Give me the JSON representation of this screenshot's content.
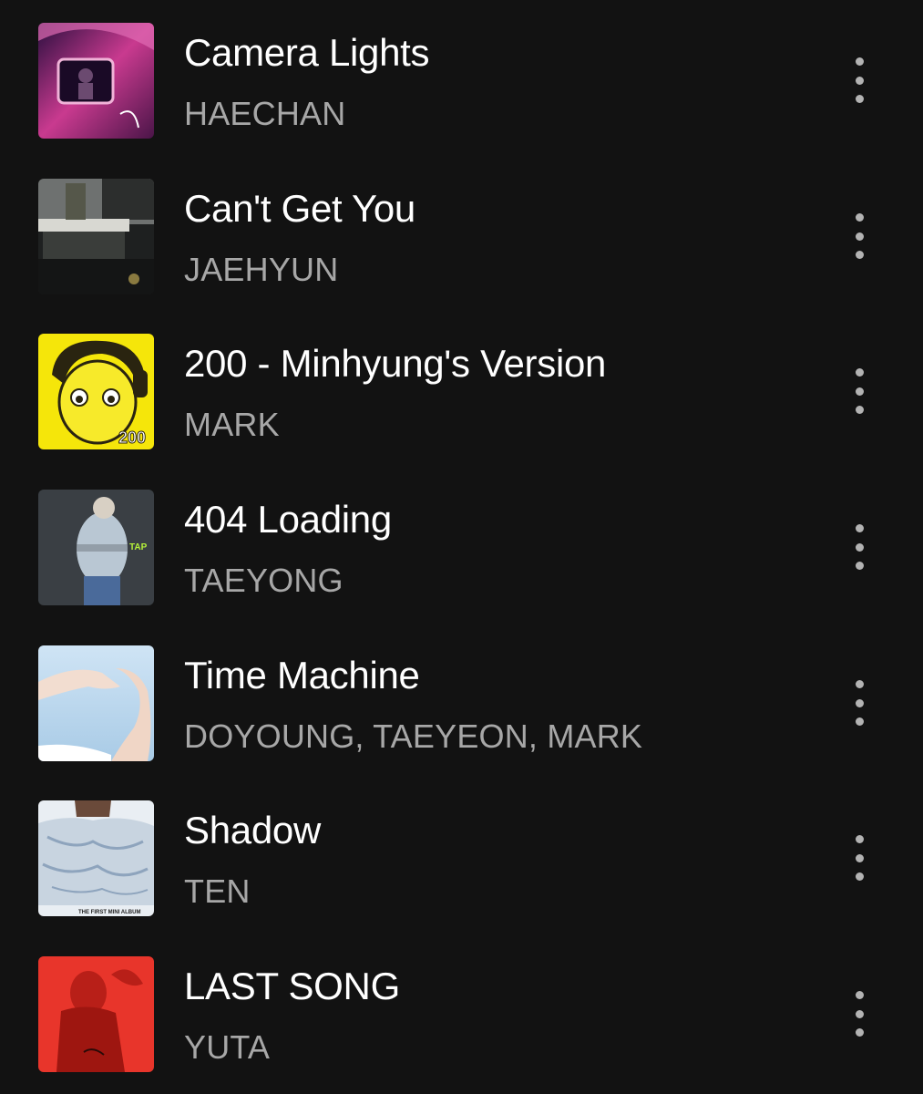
{
  "tracks": [
    {
      "title": "Camera Lights",
      "artist": "HAECHAN",
      "cover_colors": [
        "#2a0f3f",
        "#c93a8f"
      ]
    },
    {
      "title": "Can't Get You",
      "artist": "JAEHYUN",
      "cover_colors": [
        "#1e2020",
        "#5a5c58"
      ]
    },
    {
      "title": "200 - Minhyung's Version",
      "artist": "MARK",
      "cover_colors": [
        "#f5e60a",
        "#2a2410"
      ],
      "cover_text": "200"
    },
    {
      "title": "404 Loading",
      "artist": "TAEYONG",
      "cover_colors": [
        "#3a3f44",
        "#b9c7d3"
      ],
      "cover_text": "TAP"
    },
    {
      "title": "Time Machine",
      "artist": "DOYOUNG, TAEYEON, MARK",
      "cover_colors": [
        "#cfe4f5",
        "#f2ddd0"
      ]
    },
    {
      "title": "Shadow",
      "artist": "TEN",
      "cover_colors": [
        "#e9eef3",
        "#8ea4bd"
      ],
      "cover_text": "THE FIRST MINI ALBUM"
    },
    {
      "title": "LAST SONG",
      "artist": "YUTA",
      "cover_colors": [
        "#e8352b",
        "#6b0d0a"
      ]
    }
  ],
  "icons": {
    "more": "more-vertical-icon"
  }
}
